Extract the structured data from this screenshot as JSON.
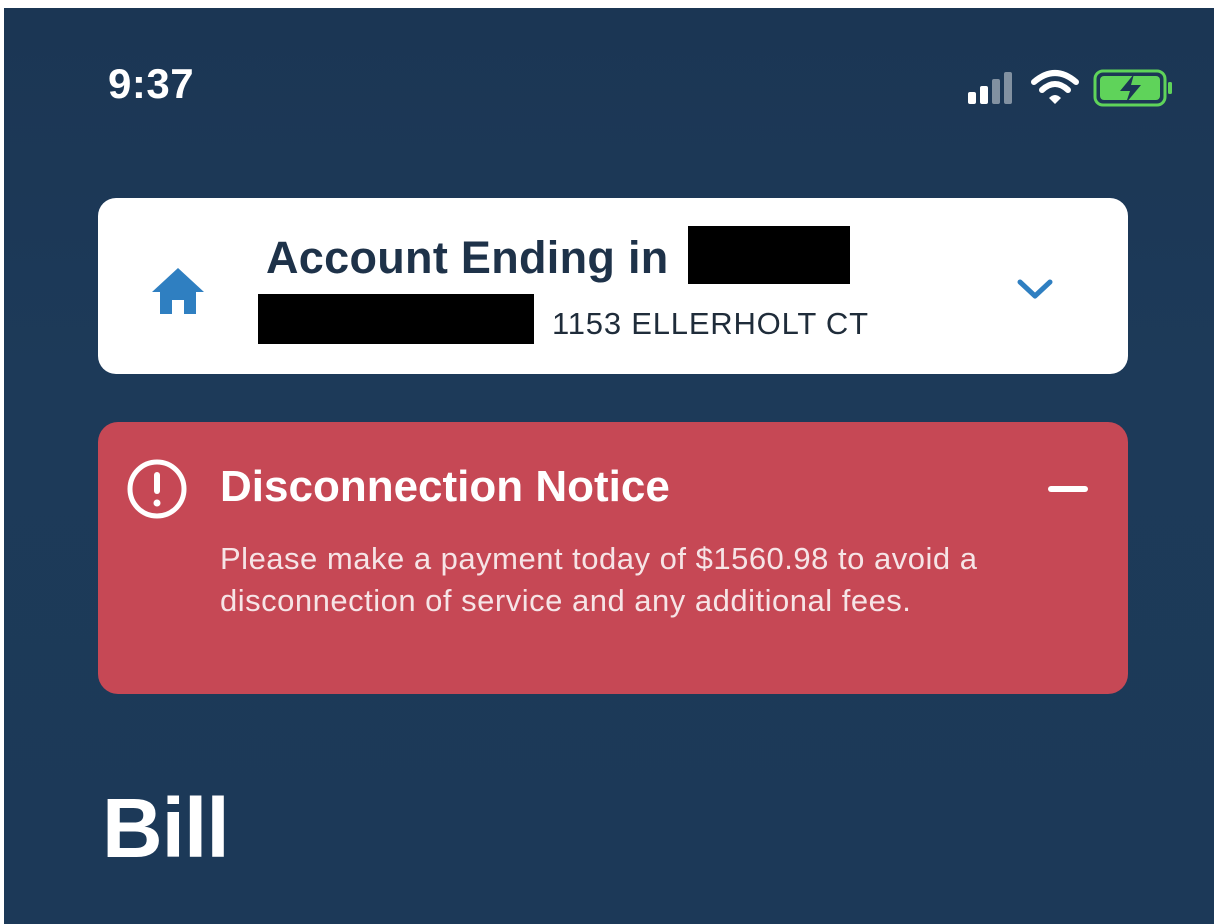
{
  "status_bar": {
    "time": "9:37",
    "icons": [
      "cellular-signal-icon",
      "wifi-icon",
      "battery-charging-icon"
    ],
    "battery_color": "#5fd35a"
  },
  "account": {
    "title": "Account Ending in",
    "address": "1153 ELLERHOLT CT",
    "icon": "home-icon",
    "accent_color": "#2f7fc1"
  },
  "notice": {
    "title": "Disconnection Notice",
    "body": "Please make a payment today of $1560.98 to avoid a disconnection of service and any additional fees.",
    "background_color": "#c64855",
    "icon": "alert-circle-icon",
    "collapse_icon": "minus-icon"
  },
  "section": {
    "heading": "Bill"
  },
  "colors": {
    "background": "#1c3958",
    "card": "#ffffff"
  }
}
